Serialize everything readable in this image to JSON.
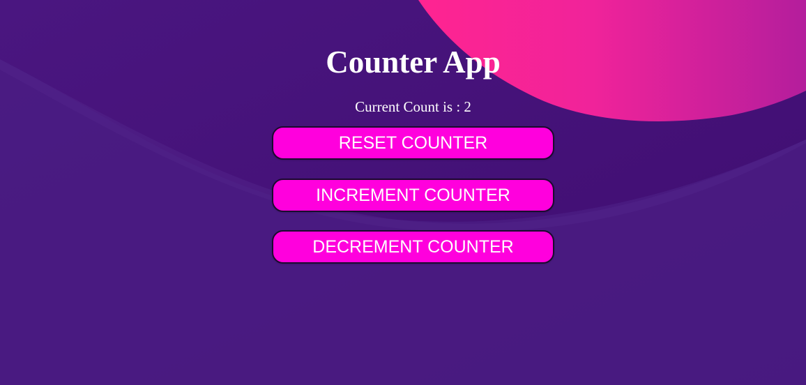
{
  "app": {
    "title": "Counter App"
  },
  "counter": {
    "label": "Current Count is : 2",
    "value": 2
  },
  "buttons": {
    "reset": "RESET COUNTER",
    "increment": "INCREMENT COUNTER",
    "decrement": "DECREMENT COUNTER"
  },
  "colors": {
    "background": "#451274",
    "wave_light": "#4c1f85",
    "blob_pink": "#ff2491",
    "blob_magenta": "#b41e9c",
    "button_fill": "#ff00dd",
    "button_border": "#1b0a2e",
    "text": "#ffffff"
  }
}
